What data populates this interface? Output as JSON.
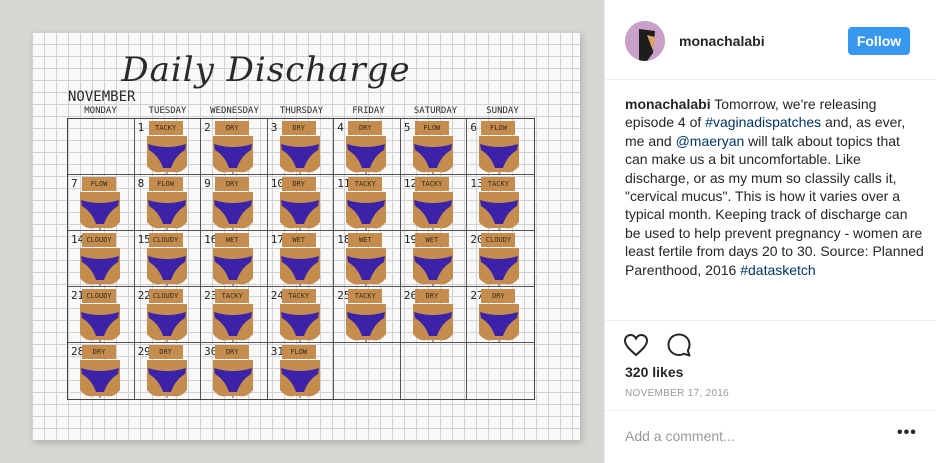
{
  "photo": {
    "title": "Daily Discharge",
    "month": "NOVEMBER",
    "weekdays": [
      "MONDAY",
      "TUESDAY",
      "WEDNESDAY",
      "THURSDAY",
      "FRIDAY",
      "SATURDAY",
      "SUNDAY"
    ],
    "days": [
      {
        "n": "",
        "label": ""
      },
      {
        "n": "1",
        "label": "TACKY"
      },
      {
        "n": "2",
        "label": "DRY"
      },
      {
        "n": "3",
        "label": "DRY"
      },
      {
        "n": "4",
        "label": "DRY"
      },
      {
        "n": "5",
        "label": "FLOW"
      },
      {
        "n": "6",
        "label": "FLOW"
      },
      {
        "n": "7",
        "label": "FLOW"
      },
      {
        "n": "8",
        "label": "FLOW"
      },
      {
        "n": "9",
        "label": "DRY"
      },
      {
        "n": "10",
        "label": "DRY"
      },
      {
        "n": "11",
        "label": "TACKY"
      },
      {
        "n": "12",
        "label": "TACKY"
      },
      {
        "n": "13",
        "label": "TACKY"
      },
      {
        "n": "14",
        "label": "CLOUDY"
      },
      {
        "n": "15",
        "label": "CLOUDY"
      },
      {
        "n": "16",
        "label": "WET"
      },
      {
        "n": "17",
        "label": "WET"
      },
      {
        "n": "18",
        "label": "WET"
      },
      {
        "n": "19",
        "label": "WET"
      },
      {
        "n": "20",
        "label": "CLOUDY"
      },
      {
        "n": "21",
        "label": "CLOUDY"
      },
      {
        "n": "22",
        "label": "CLOUDY"
      },
      {
        "n": "23",
        "label": "TACKY"
      },
      {
        "n": "24",
        "label": "TACKY"
      },
      {
        "n": "25",
        "label": "TACKY"
      },
      {
        "n": "26",
        "label": "DRY"
      },
      {
        "n": "27",
        "label": "DRY"
      },
      {
        "n": "28",
        "label": "DRY"
      },
      {
        "n": "29",
        "label": "DRY"
      },
      {
        "n": "30",
        "label": "DRY"
      },
      {
        "n": "31",
        "label": "FLOW"
      },
      {
        "n": "",
        "label": ""
      },
      {
        "n": "",
        "label": ""
      },
      {
        "n": "",
        "label": ""
      }
    ],
    "skin_color": "#c48d4e",
    "underwear_color": "#3b22a8"
  },
  "post": {
    "username": "monachalabi",
    "follow_label": "Follow",
    "caption_user": "monachalabi",
    "caption_parts": [
      {
        "t": " Tomorrow, we're releasing episode 4 of ",
        "tag": false
      },
      {
        "t": "#vaginadispatches",
        "tag": true
      },
      {
        "t": " and, as ever, me and ",
        "tag": false
      },
      {
        "t": "@maeryan",
        "tag": true
      },
      {
        "t": " will talk about topics that can make us a bit uncomfortable. Like discharge, or as my mum so classily calls it, \"cervical mucus\". This is how it varies over a typical month. Keeping track of discharge can be used to help prevent pregnancy - women are least fertile from days 20 to 30. Source: Planned Parenthood, 2016 ",
        "tag": false
      },
      {
        "t": "#datasketch",
        "tag": true
      }
    ],
    "likes": "320 likes",
    "date": "NOVEMBER 17, 2016",
    "add_comment_placeholder": "Add a comment...",
    "more_label": "•••",
    "follow_color": "#3897f0",
    "link_color": "#003569"
  }
}
